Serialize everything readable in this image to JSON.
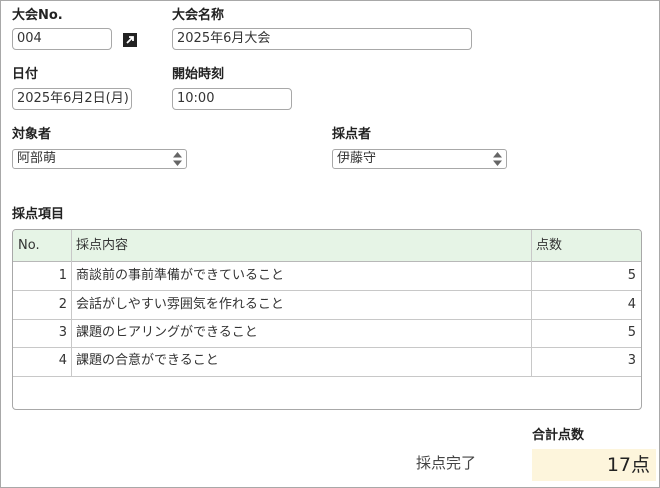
{
  "form": {
    "tournament_no": {
      "label": "大会No.",
      "value": "004"
    },
    "tournament_name": {
      "label": "大会名称",
      "value": "2025年6月大会"
    },
    "date": {
      "label": "日付",
      "value": "2025年6月2日(月)"
    },
    "start_time": {
      "label": "開始時刻",
      "value": "10:00"
    },
    "target": {
      "label": "対象者",
      "value": "阿部萌"
    },
    "scorer": {
      "label": "採点者",
      "value": "伊藤守"
    }
  },
  "scoring": {
    "section_title": "採点項目",
    "columns": [
      "No.",
      "採点内容",
      "点数"
    ],
    "rows": [
      {
        "no": "1",
        "content": "商談前の事前準備ができていること",
        "score": "5"
      },
      {
        "no": "2",
        "content": "会話がしやすい雰囲気を作れること",
        "score": "4"
      },
      {
        "no": "3",
        "content": "課題のヒアリングができること",
        "score": "5"
      },
      {
        "no": "4",
        "content": "課題の合意ができること",
        "score": "3"
      }
    ]
  },
  "footer": {
    "status": "採点完了",
    "total_label": "合計点数",
    "total_value": "17点"
  },
  "icons": {
    "open_link": "external-link-icon",
    "select_arrows": "updown-arrows-icon"
  },
  "colors": {
    "table_header_bg": "#e6f4e6",
    "total_bg": "#fdf5dc"
  }
}
